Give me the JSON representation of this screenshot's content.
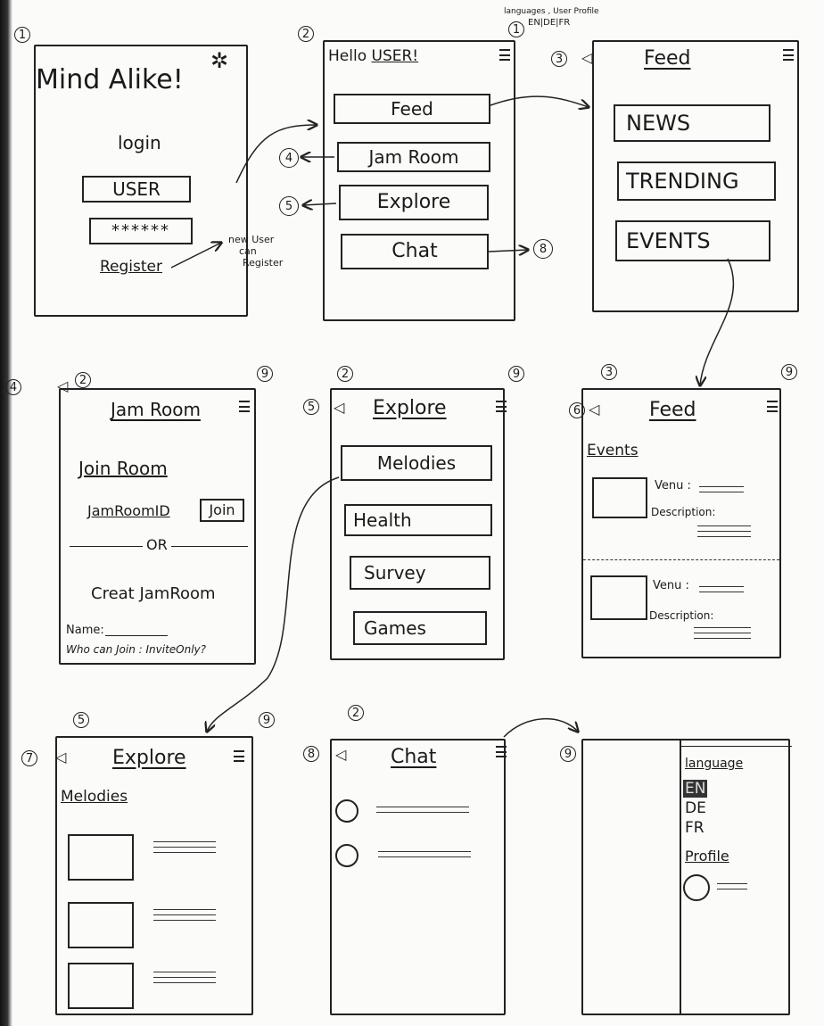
{
  "annotation_top": {
    "line1": "languages , User Profile",
    "line2": "EN|DE|FR"
  },
  "screen1": {
    "num": "1",
    "title": "Mind Alike!",
    "login_label": "login",
    "user_field": "USER",
    "password_field": "******",
    "register_link": "Register",
    "note": [
      "new User",
      "can",
      "Register"
    ]
  },
  "screen2": {
    "num": "2",
    "greeting": "Hello ",
    "user": "USER!",
    "menu_ref": "1",
    "buttons": [
      "Feed",
      "Jam Room",
      "Explore",
      "Chat"
    ],
    "refs": [
      "4",
      "5",
      "8"
    ]
  },
  "screen3": {
    "num": "3",
    "title": "Feed",
    "buttons": [
      "NEWS",
      "TRENDING",
      "EVENTS"
    ]
  },
  "screen4": {
    "num": "4",
    "back_ref": "2",
    "menu_ref": "9",
    "title": "Jam Room",
    "join_heading": "Join Room",
    "jam_room_id": "JamRoomID",
    "join_button": "Join",
    "or": "OR",
    "create_heading": "Creat JamRoom",
    "name_label": "Name:",
    "who_can_join": "Who can Join : InviteOnly?"
  },
  "screen5": {
    "num": "5",
    "back_ref": "2",
    "menu_ref": "9",
    "title": "Explore",
    "buttons": [
      "Melodies",
      "Health",
      "Survey",
      "Games"
    ]
  },
  "screen6": {
    "num": "6",
    "back_ref": "3",
    "menu_ref": "9",
    "title": "Feed",
    "section": "Events",
    "venue_label": "Venu :",
    "description_label": "Description:"
  },
  "screen7": {
    "num": "7",
    "back_ref": "5",
    "menu_ref": "9",
    "title": "Explore",
    "section": "Melodies"
  },
  "screen8": {
    "num": "8",
    "back_ref": "2",
    "title": "Chat"
  },
  "screen9": {
    "num": "9",
    "language_heading": "language",
    "languages": [
      "EN",
      "DE",
      "FR"
    ],
    "selected_language": "EN",
    "profile_heading": "Profile"
  }
}
